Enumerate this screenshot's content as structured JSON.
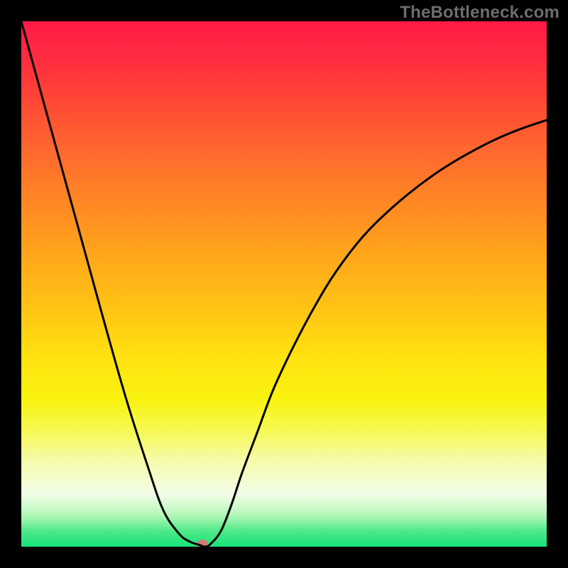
{
  "watermark": "TheBottleneck.com",
  "chart_data": {
    "type": "line",
    "title": "",
    "xlabel": "",
    "ylabel": "",
    "xlim": [
      0,
      100
    ],
    "ylim": [
      0,
      100
    ],
    "x": [
      0,
      4,
      8,
      12,
      16,
      20,
      24,
      27,
      30,
      32,
      34,
      35,
      36,
      38,
      40,
      42,
      45,
      48,
      52,
      56,
      60,
      65,
      70,
      75,
      80,
      85,
      90,
      95,
      100
    ],
    "y": [
      100,
      85.5,
      71,
      56.5,
      42,
      28,
      15.5,
      7,
      2.5,
      1,
      0.3,
      0,
      0.5,
      3,
      8,
      14,
      22,
      30,
      38.5,
      46,
      52.5,
      59,
      64,
      68.2,
      71.8,
      74.8,
      77.4,
      79.5,
      81.2
    ],
    "series_name": "bottleneck-curve",
    "marker": {
      "x_pct": 34.5,
      "y_pct": 0.5
    },
    "gradient_stops": [
      {
        "pct": 0,
        "color": "#ff1a46"
      },
      {
        "pct": 50,
        "color": "#ffc814"
      },
      {
        "pct": 78,
        "color": "#f6f955"
      },
      {
        "pct": 100,
        "color": "#17e37a"
      }
    ]
  }
}
